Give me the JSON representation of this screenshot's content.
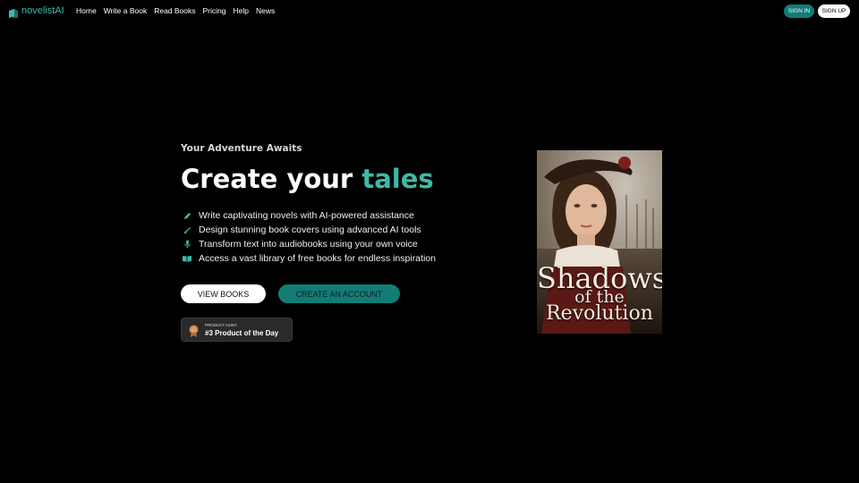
{
  "nav": {
    "logo_text": "novelistAI",
    "links": [
      "Home",
      "Write a Book",
      "Read Books",
      "Pricing",
      "Help",
      "News"
    ],
    "signin_label": "SIGN IN",
    "signup_label": "SIGN UP"
  },
  "hero": {
    "eyebrow": "Your Adventure Awaits",
    "headline_part1": "Create your ",
    "headline_accent": "tales",
    "features": [
      {
        "icon": "pen-icon",
        "text": "Write captivating novels with AI-powered assistance"
      },
      {
        "icon": "brush-icon",
        "text": "Design stunning book covers using advanced AI tools"
      },
      {
        "icon": "microphone-icon",
        "text": "Transform text into audiobooks using your own voice"
      },
      {
        "icon": "book-icon",
        "text": "Access a vast library of free books for endless inspiration"
      }
    ],
    "view_books_label": "VIEW BOOKS",
    "create_account_label": "CREATE AN ACCOUNT",
    "product_hunt": {
      "top_label": "PRODUCT HUNT",
      "main_label": "#3 Product of the Day"
    }
  },
  "cover": {
    "title_line1": "Shadows",
    "title_line2": "of the",
    "title_line3": "Revolution"
  },
  "colors": {
    "accent": "#3fb9a7",
    "button_teal": "#137d75",
    "background": "#000000"
  }
}
